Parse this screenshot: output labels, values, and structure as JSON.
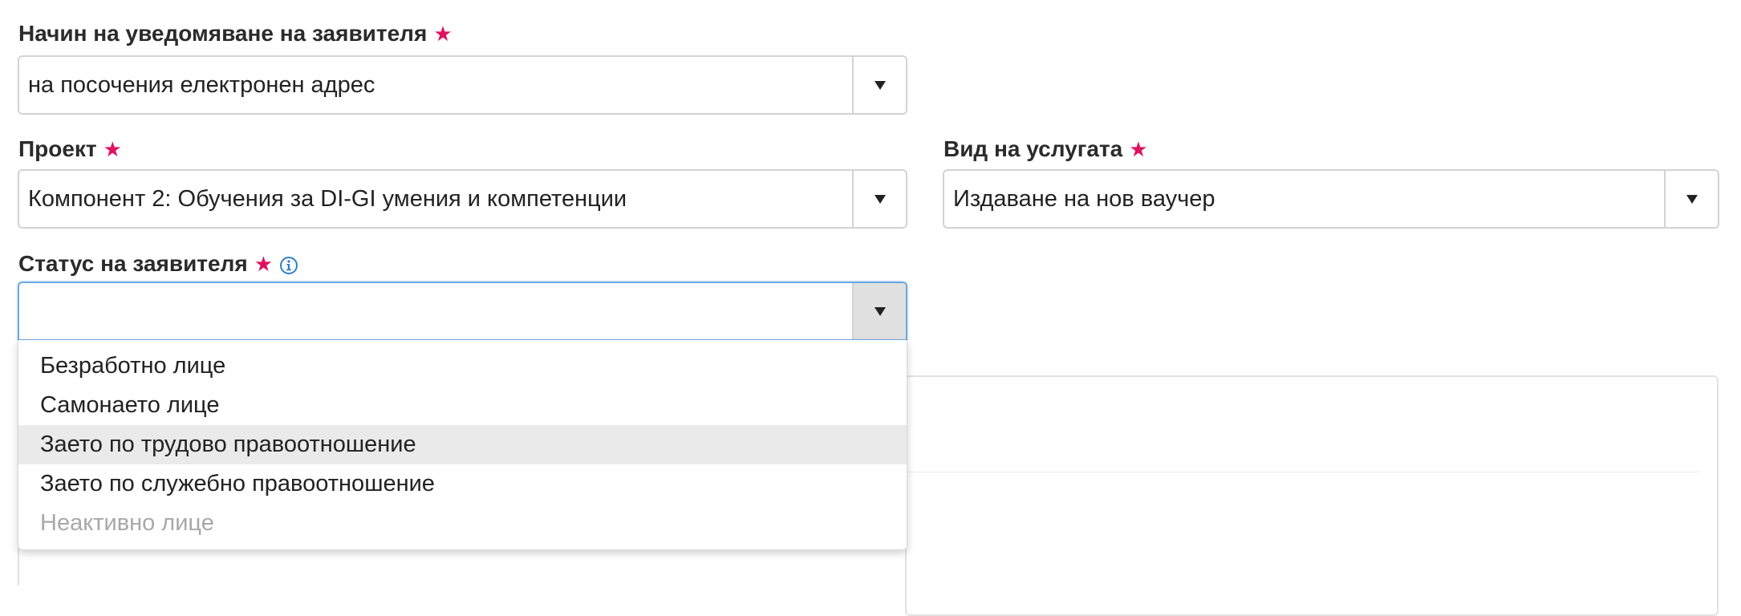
{
  "notification": {
    "label": "Начин на уведомяване на заявителя",
    "required_mark": "★",
    "value": "на посочения електронен адрес",
    "arrow_icon": "caret-down-icon"
  },
  "project": {
    "label": "Проект",
    "required_mark": "★",
    "value": "Компонент 2: Обучения за DI-GI умения и компетенции",
    "arrow_icon": "caret-down-icon"
  },
  "service_type": {
    "label": "Вид на услугата",
    "required_mark": "★",
    "value": "Издаване на нов ваучер",
    "arrow_icon": "caret-down-icon"
  },
  "applicant_status": {
    "label": "Статус на заявителя",
    "required_mark": "★",
    "info_icon": "info-icon",
    "value": "",
    "arrow_icon": "caret-down-icon",
    "options": [
      {
        "label": "Безработно лице",
        "state": "normal"
      },
      {
        "label": "Самонаето лице",
        "state": "normal"
      },
      {
        "label": "Заето по трудово правоотношение",
        "state": "hover"
      },
      {
        "label": "Заето по служебно правоотношение",
        "state": "normal"
      },
      {
        "label": "Неактивно лице",
        "state": "disabled"
      }
    ]
  },
  "colors": {
    "required_star": "#e0115f",
    "info_icon": "#2f7fc8",
    "focus_border": "#6aa9e0",
    "option_hover_bg": "#eaeaea",
    "option_disabled_text": "#a8a8a8"
  }
}
